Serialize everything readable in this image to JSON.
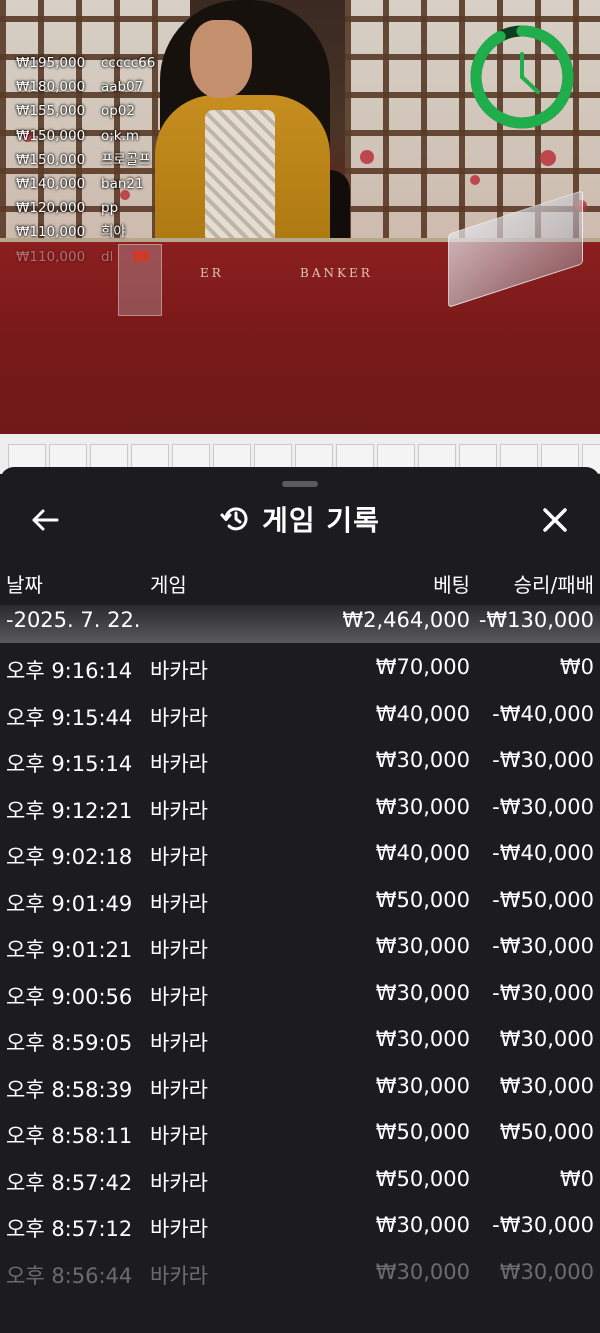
{
  "winners": [
    {
      "amount": "₩195,000",
      "user": "ccccc66"
    },
    {
      "amount": "₩180,000",
      "user": "aab07"
    },
    {
      "amount": "₩155,000",
      "user": "op02"
    },
    {
      "amount": "₩150,000",
      "user": "o;k.m"
    },
    {
      "amount": "₩150,000",
      "user": "프로골프"
    },
    {
      "amount": "₩140,000",
      "user": "ban21"
    },
    {
      "amount": "₩120,000",
      "user": "pp"
    },
    {
      "amount": "₩110,000",
      "user": "희야"
    },
    {
      "amount": "₩110,000",
      "user": "dl"
    }
  ],
  "table_labels": {
    "player": "ER",
    "banker": "BANKER"
  },
  "timer": {
    "progress": 0.92,
    "color": "#1fae4b"
  },
  "sheet": {
    "title": "게임 기록",
    "back_icon": "arrow-left-icon",
    "close_icon": "close-icon",
    "history_icon": "history-clock-icon"
  },
  "columns": {
    "date": "날짜",
    "game": "게임",
    "bet": "베팅",
    "result": "승리/패배"
  },
  "summary": {
    "date": "-2025. 7. 22.",
    "bet": "₩2,464,000",
    "result": "-₩130,000"
  },
  "rows": [
    {
      "time": "오후 9:16:14",
      "game": "바카라",
      "bet": "₩70,000",
      "result": "₩0"
    },
    {
      "time": "오후 9:15:44",
      "game": "바카라",
      "bet": "₩40,000",
      "result": "-₩40,000"
    },
    {
      "time": "오후 9:15:14",
      "game": "바카라",
      "bet": "₩30,000",
      "result": "-₩30,000"
    },
    {
      "time": "오후 9:12:21",
      "game": "바카라",
      "bet": "₩30,000",
      "result": "-₩30,000"
    },
    {
      "time": "오후 9:02:18",
      "game": "바카라",
      "bet": "₩40,000",
      "result": "-₩40,000"
    },
    {
      "time": "오후 9:01:49",
      "game": "바카라",
      "bet": "₩50,000",
      "result": "-₩50,000"
    },
    {
      "time": "오후 9:01:21",
      "game": "바카라",
      "bet": "₩30,000",
      "result": "-₩30,000"
    },
    {
      "time": "오후 9:00:56",
      "game": "바카라",
      "bet": "₩30,000",
      "result": "-₩30,000"
    },
    {
      "time": "오후 8:59:05",
      "game": "바카라",
      "bet": "₩30,000",
      "result": "₩30,000"
    },
    {
      "time": "오후 8:58:39",
      "game": "바카라",
      "bet": "₩30,000",
      "result": "₩30,000"
    },
    {
      "time": "오후 8:58:11",
      "game": "바카라",
      "bet": "₩50,000",
      "result": "₩50,000"
    },
    {
      "time": "오후 8:57:42",
      "game": "바카라",
      "bet": "₩50,000",
      "result": "₩0"
    },
    {
      "time": "오후 8:57:12",
      "game": "바카라",
      "bet": "₩30,000",
      "result": "-₩30,000"
    },
    {
      "time": "오후 8:56:44",
      "game": "바카라",
      "bet": "₩30,000",
      "result": "₩30,000"
    }
  ]
}
